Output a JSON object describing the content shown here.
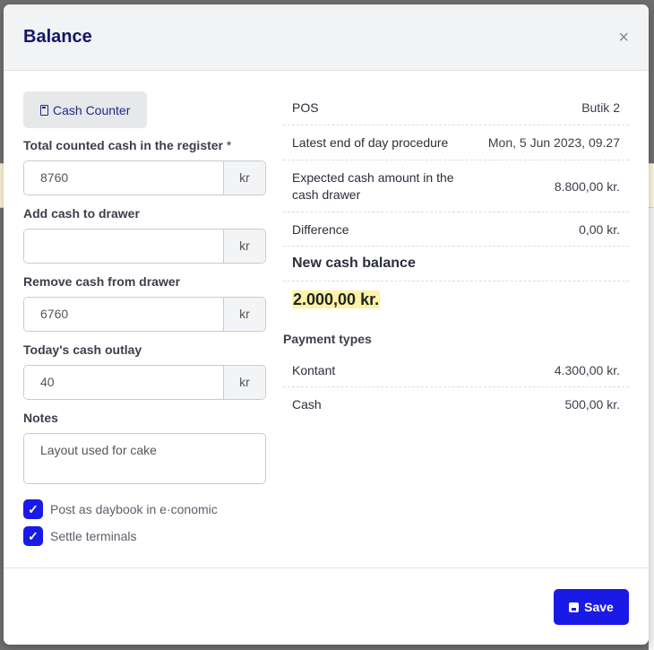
{
  "modal": {
    "title": "Balance",
    "close_label": "×"
  },
  "left": {
    "cash_counter_label": "Cash Counter",
    "total_counted": {
      "label": "Total counted cash in the register",
      "required_mark": "*",
      "value": "8760",
      "unit": "kr"
    },
    "add_cash": {
      "label": "Add cash to drawer",
      "value": "",
      "unit": "kr"
    },
    "remove_cash": {
      "label": "Remove cash from drawer",
      "value": "6760",
      "unit": "kr"
    },
    "cash_outlay": {
      "label": "Today's cash outlay",
      "value": "40",
      "unit": "kr"
    },
    "notes": {
      "label": "Notes",
      "value": "Layout used for cake"
    },
    "checkboxes": [
      {
        "label": "Post as daybook in e·conomic",
        "checked": true
      },
      {
        "label": "Settle terminals",
        "checked": true
      }
    ]
  },
  "right": {
    "rows": [
      {
        "label": "POS",
        "value": "Butik 2"
      },
      {
        "label": "Latest end of day procedure",
        "value": "Mon, 5 Jun 2023, 09.27"
      },
      {
        "label": "Expected cash amount in the cash drawer",
        "value": "8.800,00 kr."
      },
      {
        "label": "Difference",
        "value": "0,00 kr."
      }
    ],
    "new_cash_balance": {
      "label": "New cash balance",
      "value": "2.000,00 kr."
    },
    "payment_types": {
      "label": "Payment types",
      "rows": [
        {
          "label": "Kontant",
          "value": "4.300,00 kr."
        },
        {
          "label": "Cash",
          "value": "500,00 kr."
        }
      ]
    }
  },
  "footer": {
    "save_label": "Save"
  },
  "colors": {
    "accent": "#1a1ae6",
    "title": "#15156a",
    "highlight": "#fff3a3"
  }
}
